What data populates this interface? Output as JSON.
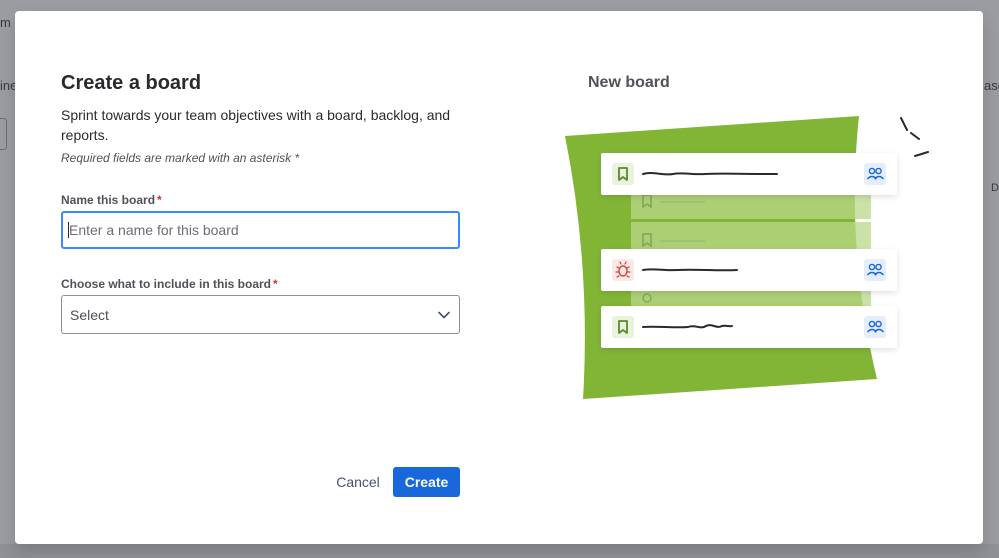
{
  "background": {
    "fragment_m": "m",
    "fragment_ine": "ine",
    "fragment_ase": "ase",
    "fragment_d": "D"
  },
  "modal": {
    "title": "Create a board",
    "description": "Sprint towards your team objectives with a board, backlog, and reports.",
    "required_note": "Required fields are marked with an asterisk *",
    "name_field": {
      "label": "Name this board",
      "required_mark": "*",
      "placeholder": "Enter a name for this board",
      "value": ""
    },
    "include_field": {
      "label": "Choose what to include in this board",
      "required_mark": "*",
      "selected": "Select"
    },
    "cancel_label": "Cancel",
    "create_label": "Create",
    "preview": {
      "title": "New board",
      "cards": [
        {
          "icon": "bookmark-icon",
          "icon_color": "#5b8a2c",
          "assignee_icon": "people-icon"
        },
        {
          "icon": "bug-icon",
          "icon_color": "#d14b3c",
          "assignee_icon": "people-icon"
        },
        {
          "icon": "bookmark-icon",
          "icon_color": "#5b8a2c",
          "assignee_icon": "people-icon"
        }
      ]
    }
  },
  "colors": {
    "primary": "#1868db",
    "focus_border": "#388bff",
    "illustration_green": "#82b536",
    "required_red": "#c9372c"
  }
}
